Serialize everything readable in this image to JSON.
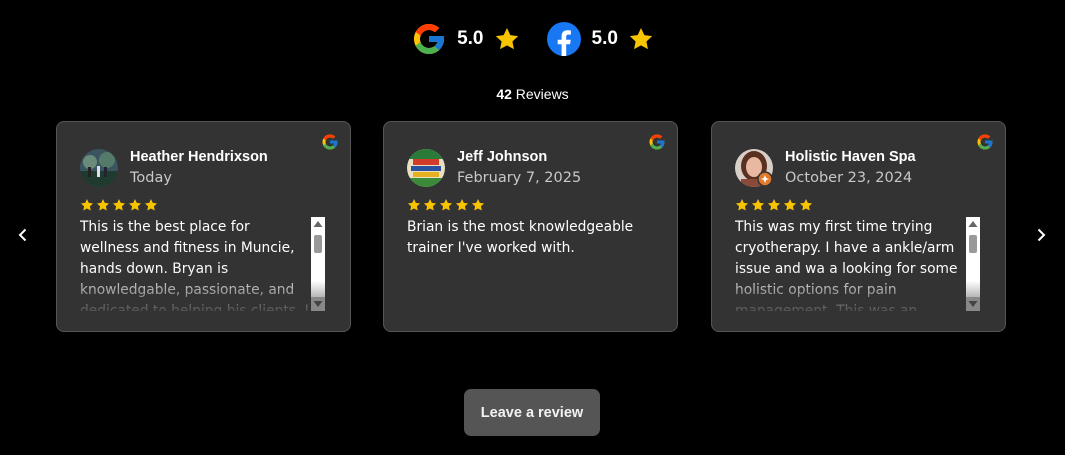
{
  "summary": {
    "google_score": "5.0",
    "facebook_score": "5.0",
    "review_count": "42",
    "review_count_suffix": " Reviews"
  },
  "colors": {
    "star": "#f7c400",
    "card_bg": "#333333",
    "button_bg": "#555555"
  },
  "reviews": [
    {
      "name": "Heather Hendrixson",
      "date": "Today",
      "rating": 5,
      "source_icon": "google-icon",
      "text": "This is the best place for wellness and fitness in Muncie, hands down. Bryan is knowledgable, passionate, and dedicated to helping his clients. I have a very"
    },
    {
      "name": "Jeff Johnson",
      "date": "February 7, 2025",
      "rating": 5,
      "source_icon": "google-icon",
      "text": "Brian is the most knowledgeable trainer I've worked with."
    },
    {
      "name": "Holistic Haven Spa",
      "date": "October 23, 2024",
      "rating": 5,
      "source_icon": "google-icon",
      "text": "This was my first time trying cryotherapy. I have a ankle/arm issue and wa a looking for some holistic options for pain management. This was an"
    }
  ],
  "leave_review_label": "Leave a review"
}
